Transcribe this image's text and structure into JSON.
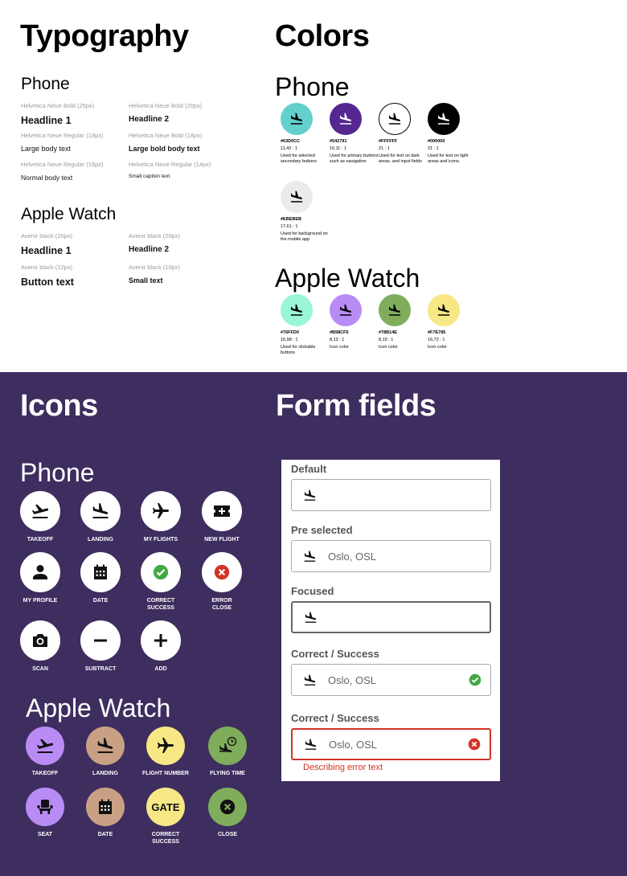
{
  "typography": {
    "title": "Typography",
    "phone": {
      "title": "Phone",
      "samples": [
        {
          "caption": "Helvetica Neue Bold (25px)",
          "text": "Headline 1"
        },
        {
          "caption": "Helvetica Neue Bold (20px)",
          "text": "Headline 2"
        },
        {
          "caption": "Helvetica Neue Regular (18px)",
          "text": "Large body text"
        },
        {
          "caption": "Helvetica Neue Bold (18px)",
          "text": "Large bold body text"
        },
        {
          "caption": "Helvetica Neue Regular (16px)",
          "text": "Normal body text"
        },
        {
          "caption": "Helvetica Neue Regular (14px)",
          "text": "Small caption text"
        }
      ]
    },
    "watch": {
      "title": "Apple Watch",
      "samples": [
        {
          "caption": "Avenir black (26px)",
          "text": "Headline 1"
        },
        {
          "caption": "Avenir black (20px)",
          "text": "Headline 2"
        },
        {
          "caption": "Avenir black (12px)",
          "text": "Button text"
        },
        {
          "caption": "Avenir black (10px)",
          "text": "Small text"
        }
      ]
    }
  },
  "colors": {
    "title": "Colors",
    "phone": {
      "title": "Phone",
      "swatches": [
        {
          "hex": "#63D0CC",
          "ratio": "11,42 : 1",
          "desc": "Used for selected secondary buttons",
          "color": "#63D0CC",
          "icon_color": "#000000"
        },
        {
          "hex": "#542791",
          "ratio": "10,11 : 1",
          "desc": "Used for primary buttons such as navigation",
          "color": "#542791",
          "icon_color": "#FFFFFF"
        },
        {
          "hex": "#FFFFFF",
          "ratio": "21 : 1",
          "desc": "Used for text on dark areas, and input fields",
          "color": "#FFFFFF",
          "icon_color": "#000000"
        },
        {
          "hex": "#000000",
          "ratio": "21 : 1",
          "desc": "Used for text on light areas and icons.",
          "color": "#000000",
          "icon_color": "#FFFFFF"
        },
        {
          "hex": "#EBEBEB",
          "ratio": "17,61 : 1",
          "desc": "Used for background on the mobile app",
          "color": "#EBEBEB",
          "icon_color": "#000000"
        }
      ]
    },
    "watch": {
      "title": "Apple Watch",
      "swatches": [
        {
          "hex": "#76FFD0",
          "ratio": "16,98 : 1",
          "desc": "Used for clickable buttons",
          "color": "#9AF7D6",
          "icon_color": "#000000"
        },
        {
          "hex": "#B98CF5",
          "ratio": "8,13 : 1",
          "desc": "Icon color",
          "color": "#B98CF5",
          "icon_color": "#000000"
        },
        {
          "hex": "#78B14E",
          "ratio": "8,19 : 1",
          "desc": "Icon color",
          "color": "#7FAD5C",
          "icon_color": "#000000"
        },
        {
          "hex": "#F7E785",
          "ratio": "16,72 : 1",
          "desc": "Icon color",
          "color": "#F7E785",
          "icon_color": "#000000"
        }
      ]
    }
  },
  "icons": {
    "title": "Icons",
    "phone": {
      "title": "Phone",
      "items": [
        {
          "label": "TAKEOFF",
          "icon": "takeoff-icon"
        },
        {
          "label": "LANDING",
          "icon": "landing-icon"
        },
        {
          "label": "MY FLIGHTS",
          "icon": "airplane-icon"
        },
        {
          "label": "NEW FLIGHT",
          "icon": "ticket-plus-icon"
        },
        {
          "label": "MY PROFILE",
          "icon": "person-icon"
        },
        {
          "label": "DATE",
          "icon": "calendar-icon"
        },
        {
          "label": "CORRECT SUCCESS",
          "icon": "check-circle-icon"
        },
        {
          "label": "ERROR CLOSE",
          "icon": "error-circle-icon"
        },
        {
          "label": "SCAN",
          "icon": "camera-icon"
        },
        {
          "label": "SUBTRACT",
          "icon": "minus-icon"
        },
        {
          "label": "ADD",
          "icon": "plus-icon"
        }
      ]
    },
    "watch": {
      "title": "Apple Watch",
      "items": [
        {
          "label": "TAKEOFF",
          "icon": "takeoff-icon",
          "color": "#B98CF5"
        },
        {
          "label": "LANDING",
          "icon": "landing-icon",
          "color": "#C9A083"
        },
        {
          "label": "FLIGHT NUMBER",
          "icon": "airplane-icon",
          "color": "#F7E785"
        },
        {
          "label": "FLYING TIME",
          "icon": "landing-clock-icon",
          "color": "#7FAD5C"
        },
        {
          "label": "SEAT",
          "icon": "seat-icon",
          "color": "#B98CF5"
        },
        {
          "label": "DATE",
          "icon": "calendar-icon",
          "color": "#C9A083"
        },
        {
          "label": "CORRECT SUCCESS",
          "icon": "gate-icon",
          "color": "#F7E785",
          "text": "GATE"
        },
        {
          "label": "CLOSE",
          "icon": "close-circle-icon",
          "color": "#7FAD5C"
        }
      ]
    }
  },
  "form": {
    "title": "Form fields",
    "fields": [
      {
        "label": "Default",
        "value": "",
        "state": "default"
      },
      {
        "label": "Pre selected",
        "value": "Oslo, OSL",
        "state": "preselected"
      },
      {
        "label": "Focused",
        "value": "",
        "state": "focused"
      },
      {
        "label": "Correct / Success",
        "value": "Oslo, OSL",
        "state": "success"
      },
      {
        "label": "Correct / Success",
        "value": "Oslo, OSL",
        "state": "error"
      }
    ],
    "error_text": "Describing error text",
    "success_color": "#45A845",
    "error_color": "#D33327"
  },
  "theme": {
    "dark_bg": "#3E2D5F"
  }
}
